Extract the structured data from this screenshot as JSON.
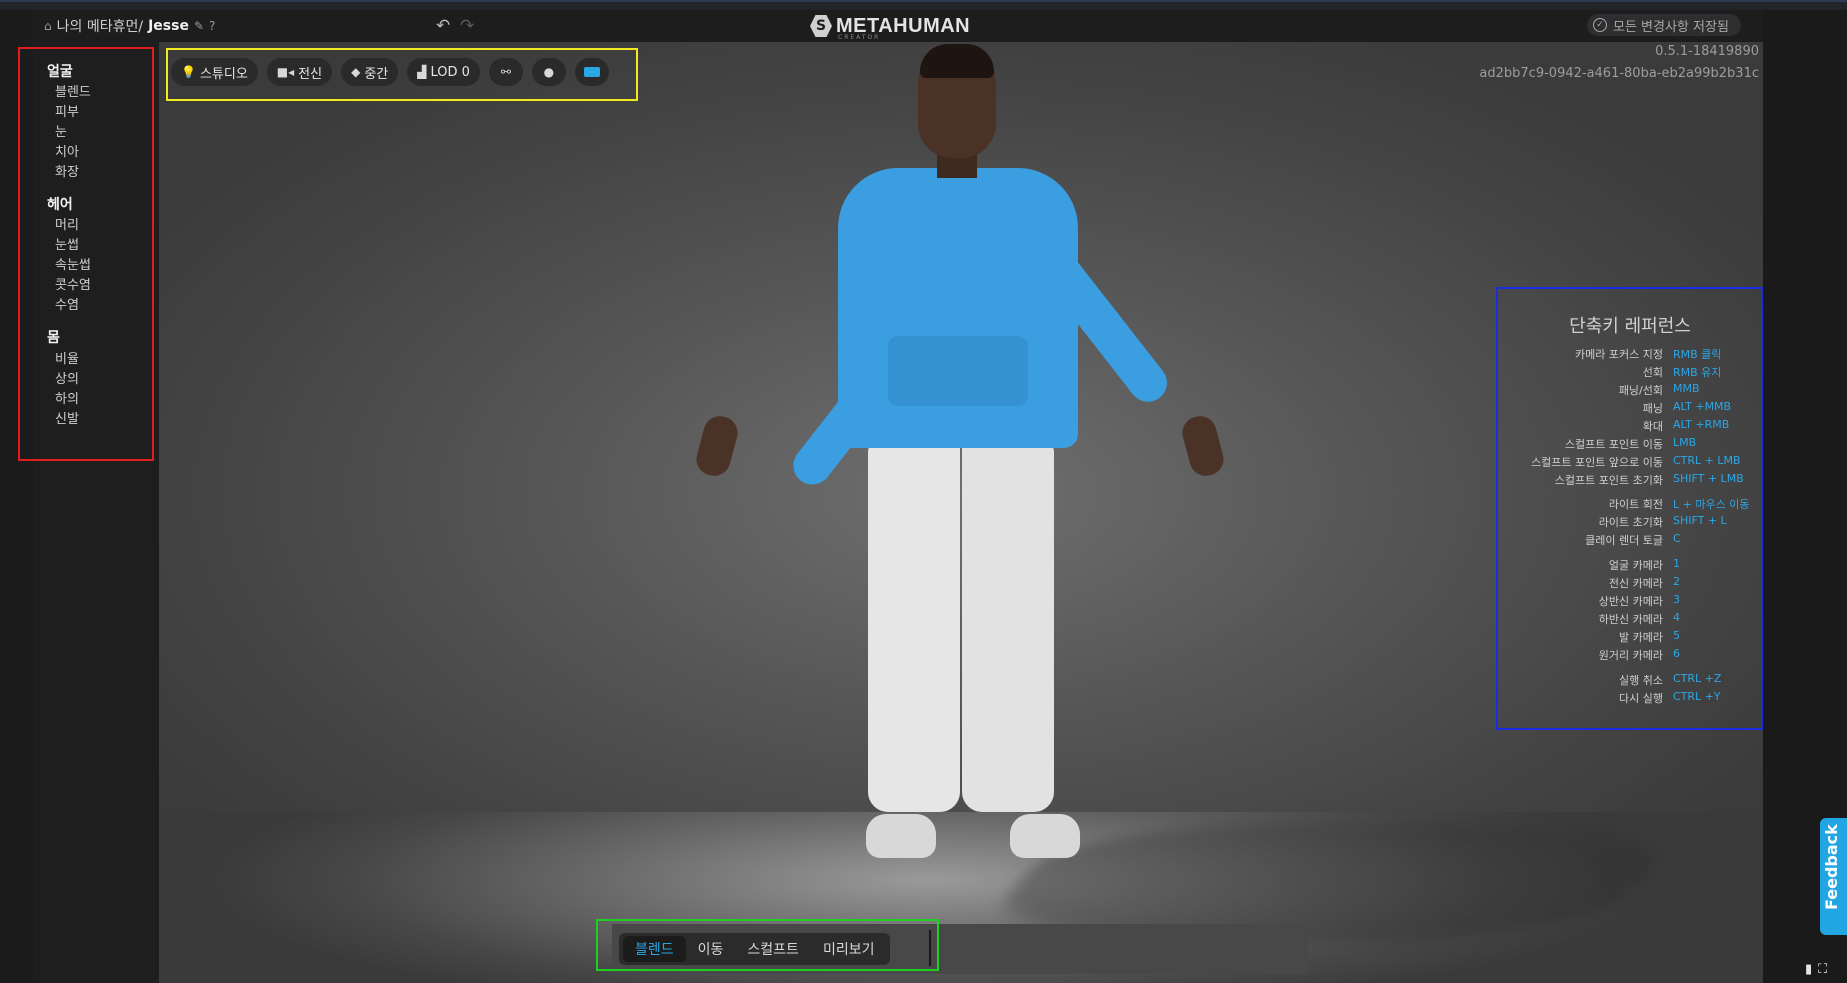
{
  "header": {
    "breadcrumb_parent": "나의 메타휴먼/",
    "breadcrumb_name": "Jesse",
    "logo_text": "METAHUMAN",
    "logo_sub": "CREATOR",
    "saved_status": "모든 변경사항 저장됨"
  },
  "sidebar": {
    "face": {
      "label": "얼굴",
      "items": [
        "블렌드",
        "피부",
        "눈",
        "치아",
        "화장"
      ]
    },
    "hair": {
      "label": "헤어",
      "items": [
        "머리",
        "눈썹",
        "속눈썹",
        "콧수염",
        "수염"
      ]
    },
    "body": {
      "label": "몸",
      "items": [
        "비율",
        "상의",
        "하의",
        "신발"
      ]
    }
  },
  "toolbar": {
    "lighting": "스튜디오",
    "camera": "전신",
    "quality": "중간",
    "lod": "LOD 0"
  },
  "viewport": {
    "version": "0.5.1-18419890",
    "uuid": "ad2bb7c9-0942-a461-80ba-eb2a99b2b31c"
  },
  "shortcuts": {
    "title": "단축키 레퍼런스",
    "rows": [
      {
        "k": "카메라 포커스 지정",
        "v": "RMB 클릭"
      },
      {
        "k": "선회",
        "v": "RMB 유지"
      },
      {
        "k": "패닝/선회",
        "v": "MMB"
      },
      {
        "k": "패닝",
        "v": "ALT +MMB"
      },
      {
        "k": "확대",
        "v": "ALT +RMB"
      },
      {
        "k": "스컬프트 포인트 이동",
        "v": "LMB"
      },
      {
        "k": "스컬프트 포인트 앞으로 이동",
        "v": "CTRL + LMB"
      },
      {
        "k": "스컬프트 포인트 초기화",
        "v": "SHIFT + LMB"
      },
      {
        "k": "라이트 회전",
        "v": "L + 마우스 이동"
      },
      {
        "k": "라이트 초기화",
        "v": "SHIFT + L"
      },
      {
        "k": "클레이 렌더 토글",
        "v": "C"
      },
      {
        "k": "얼굴 카메라",
        "v": "1"
      },
      {
        "k": "전신 카메라",
        "v": "2"
      },
      {
        "k": "상반신 카메라",
        "v": "3"
      },
      {
        "k": "하반신 카메라",
        "v": "4"
      },
      {
        "k": "발 카메라",
        "v": "5"
      },
      {
        "k": "원거리 카메라",
        "v": "6"
      },
      {
        "k": "실행 취소",
        "v": "CTRL +Z"
      },
      {
        "k": "다시 실행",
        "v": "CTRL +Y"
      }
    ]
  },
  "modes": [
    "블렌드",
    "이동",
    "스컬프트",
    "미리보기"
  ],
  "feedback": "Feedback",
  "colors": {
    "accent": "#2aa7e6",
    "red_box": "#e01e1e",
    "yellow_box": "#f2ea20",
    "blue_box": "#1a2ee0",
    "green_box": "#1fd11f"
  }
}
